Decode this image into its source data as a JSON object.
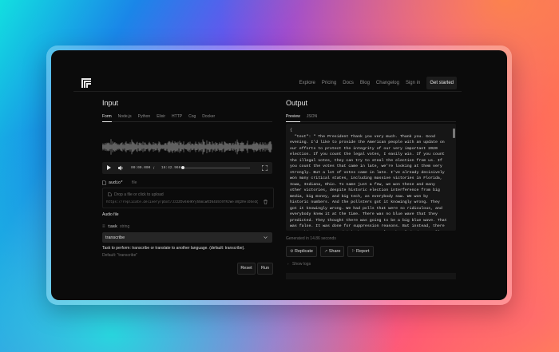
{
  "nav": {
    "links": [
      "Explore",
      "Pricing",
      "Docs",
      "Blog",
      "Changelog",
      "Sign in"
    ],
    "cta": "Get started"
  },
  "input": {
    "title": "Input",
    "tabs": [
      "Form",
      "Node.js",
      "Python",
      "Elixir",
      "HTTP",
      "Cog",
      "Docker"
    ],
    "player": {
      "current": "00:00.000",
      "sep": "/",
      "duration": "16:42.966"
    },
    "audio_field": {
      "name": "audio*",
      "type": "file",
      "drop_text": "Drop a file or click to upload",
      "url": "https://replicate.delivery/pbxt/Jz2ZOv6kHKYy55mLWOIN4b5t0fRJWel0Q2RelO5e3Q...",
      "caption": "Audio file"
    },
    "task_field": {
      "name": "task",
      "type": "string",
      "value": "transcribe",
      "help": "Task to perform: transcribe or translate to another language. (default: transcribe).",
      "default": "Default: \"transcribe\""
    },
    "reset_label": "Reset",
    "run_label": "Run"
  },
  "output": {
    "title": "Output",
    "tabs": [
      "Preview",
      "JSON"
    ],
    "code": "{\n  \"text\": \" The President Thank you very much. Thank you. Good evening. I'd like to provide the American people with an update on our efforts to protect the integrity of our very important 2020 election. If you count the legal votes, I easily win. If you count the illegal votes, they can try to steal the election from us. If you count the votes that came in late, we're looking at them very strongly. But a lot of votes came in late. I've already decisively won many critical states, including massive victories in Florida, Iowa, Indiana, Ohio. To name just a few, we won these and many other victories, despite historic election interference from big media, big money, and big tech, as everybody saw. We won by historic numbers. And the pollsters got it knowingly wrong. They got it knowingly wrong. We had polls that were so ridiculous, and everybody knew it at the time. There was no blue wave that they predicted. They thought there was going to be a big blue wave. That was false. It was done for suppression reasons. But instead, there was a big red wave, and it's been properly acknowledged, actually, by the media. They were, I think, very impressed. But that",
    "generated": "Generated in 14.86 seconds",
    "replicate_label": "Replicate",
    "share_label": "Share",
    "report_label": "Report",
    "show_logs": "Show logs"
  }
}
